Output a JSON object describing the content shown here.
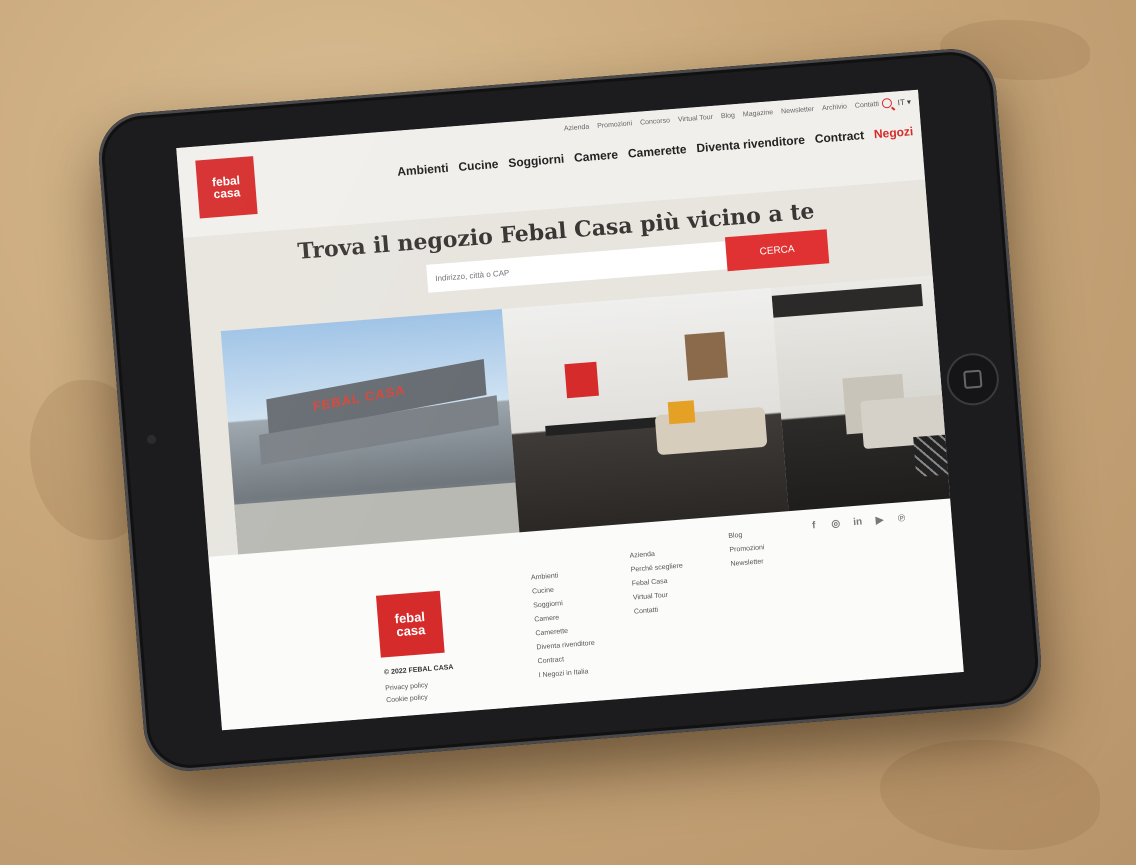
{
  "colors": {
    "brand": "#d62b2b",
    "background": "#c8a77a"
  },
  "logo": {
    "line1": "febal",
    "line2": "casa"
  },
  "header": {
    "top_links": [
      "Azienda",
      "Promozioni",
      "Concorso",
      "Virtual Tour",
      "Blog",
      "Magazine",
      "Newsletter",
      "Archivio",
      "Contatti"
    ],
    "lang": "IT ▾",
    "icons": {
      "search": "search-icon"
    },
    "main_nav": [
      "Ambienti",
      "Cucine",
      "Soggiorni",
      "Camere",
      "Camerette",
      "Diventa rivenditore",
      "Contract",
      "Negozi"
    ]
  },
  "hero": {
    "title": "Trova il negozio Febal Casa più vicino a te",
    "search_placeholder": "Indirizzo, città o CAP",
    "search_button": "CERCA",
    "photo_sign": "FEBAL CASA"
  },
  "footer": {
    "copyright": "© 2022 FEBAL CASA",
    "legal_links": [
      "Privacy policy",
      "Cookie policy"
    ],
    "col1": [
      "Ambienti",
      "Cucine",
      "Soggiorni",
      "Camere",
      "Camerette",
      "Diventa rivenditore",
      "Contract",
      "I Negozi in Italia"
    ],
    "col2": [
      "Azienda",
      "Perché scegliere",
      "Febal Casa",
      "Virtual Tour",
      "Contatti"
    ],
    "col3": [
      "Blog",
      "Promozioni",
      "Newsletter"
    ],
    "social": [
      "f",
      "◎",
      "in",
      "▶",
      "℗"
    ]
  }
}
